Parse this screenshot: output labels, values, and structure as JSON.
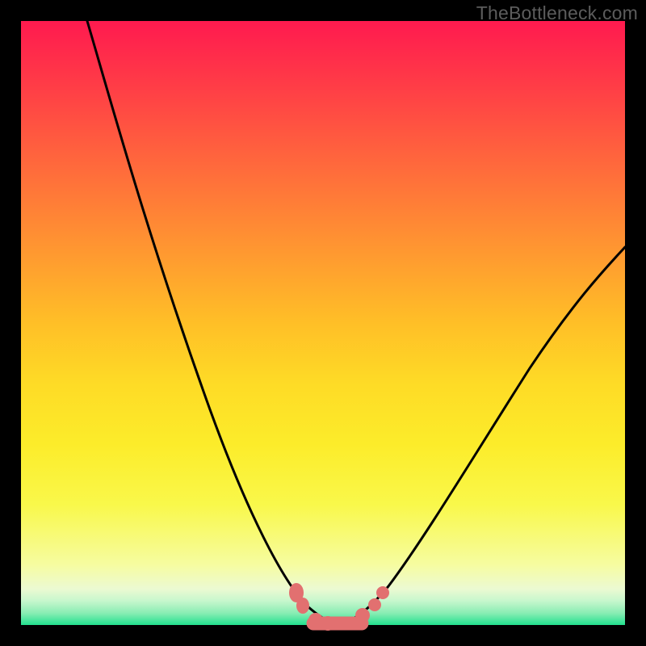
{
  "watermark": "TheBottleneck.com",
  "colors": {
    "frame": "#000000",
    "curve_stroke": "#000000",
    "marker_fill": "#e27070",
    "marker_stroke": "#c45858"
  },
  "chart_data": {
    "type": "line",
    "title": "",
    "xlabel": "",
    "ylabel": "",
    "xlim": [
      0,
      100
    ],
    "ylim": [
      0,
      100
    ],
    "series": [
      {
        "name": "left_arm",
        "x": [
          11,
          14,
          18,
          22,
          26,
          30,
          34,
          38,
          41,
          44,
          47,
          49,
          51
        ],
        "y": [
          100,
          89,
          76,
          63,
          50,
          38,
          27,
          17,
          10,
          5,
          2,
          0.5,
          0
        ]
      },
      {
        "name": "right_arm",
        "x": [
          51,
          54,
          56,
          58,
          62,
          66,
          72,
          80,
          90,
          100
        ],
        "y": [
          0,
          0.2,
          1,
          3,
          8,
          15,
          24,
          36,
          50,
          63
        ]
      }
    ],
    "markers_left": {
      "x": [
        46,
        46.8,
        49,
        51
      ],
      "y": [
        4.5,
        2.5,
        0.6,
        0.2
      ]
    },
    "markers_right": {
      "x": [
        56.5,
        58.5,
        59.5
      ],
      "y": [
        1.5,
        3.5,
        5.5
      ]
    },
    "flat_segment": {
      "x_start": 49,
      "x_end": 56.5,
      "y": 0.2
    }
  }
}
